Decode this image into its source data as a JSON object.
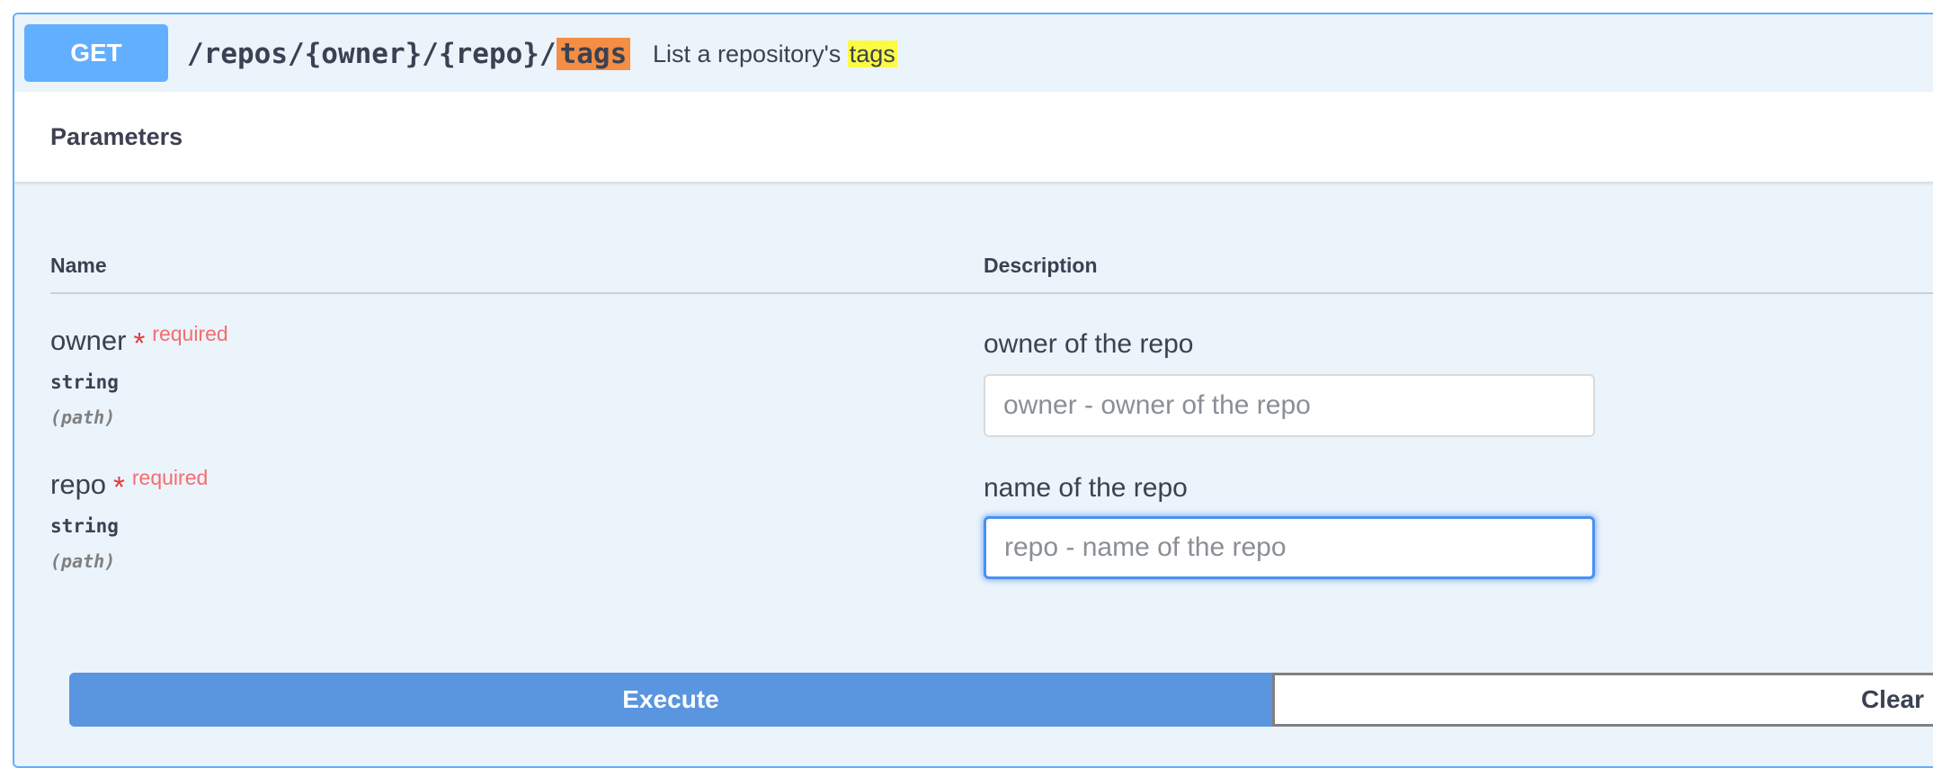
{
  "operation": {
    "method": "GET",
    "path_prefix": "/repos/{owner}/{repo}/",
    "path_highlight": "tags",
    "description_prefix": "List a repository's ",
    "description_highlight": "tags"
  },
  "parameters": {
    "title": "Parameters",
    "columns": {
      "name": "Name",
      "description": "Description"
    },
    "items": [
      {
        "name": "owner",
        "required_star": "*",
        "required_label": "required",
        "type": "string",
        "in": "(path)",
        "description": "owner of the repo",
        "placeholder": "owner - owner of the repo",
        "value": ""
      },
      {
        "name": "repo",
        "required_star": "*",
        "required_label": "required",
        "type": "string",
        "in": "(path)",
        "description": "name of the repo",
        "placeholder": "repo - name of the repo",
        "value": ""
      }
    ]
  },
  "actions": {
    "execute_label": "Execute",
    "clear_label": "Clear"
  },
  "colors": {
    "method_get": "#61affe",
    "path_highlight": "#f38e44",
    "search_highlight": "#fbfb44",
    "execute": "#5a95df",
    "required": "#f36e6e"
  }
}
